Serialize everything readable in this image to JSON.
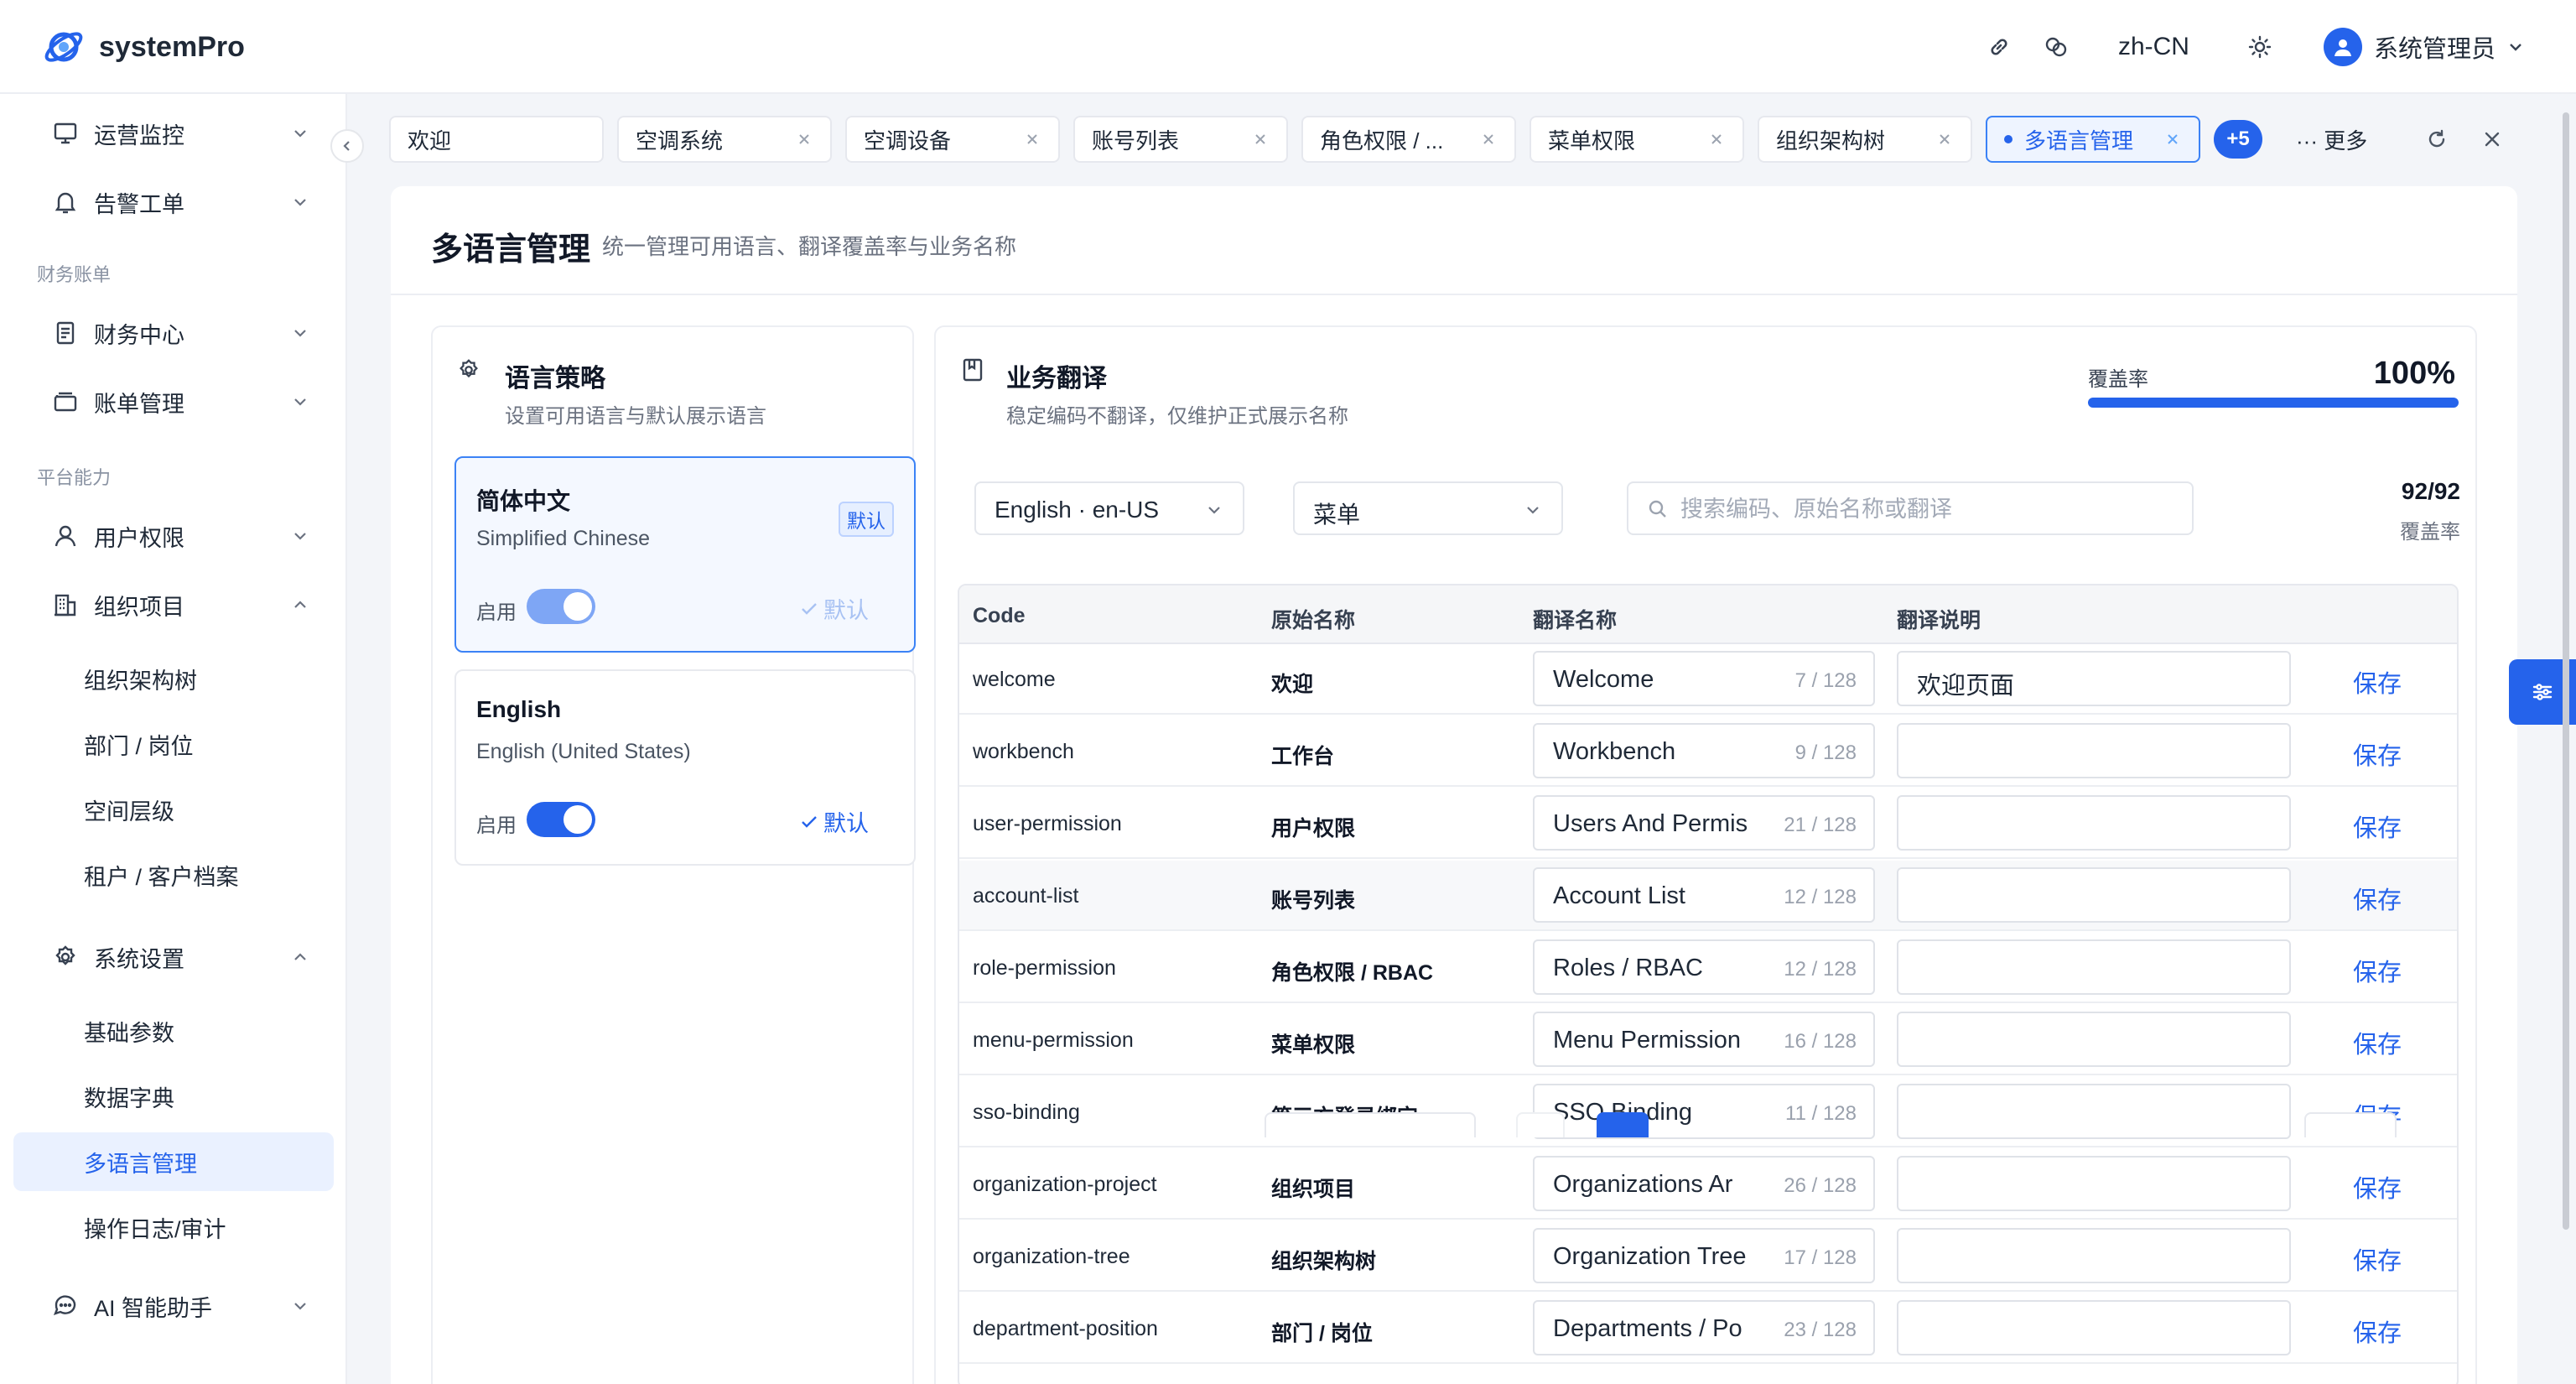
{
  "app": {
    "name": "systemPro",
    "locale": "zh-CN",
    "user": "系统管理员"
  },
  "sidebar": {
    "items": [
      {
        "label": "运营监控"
      },
      {
        "label": "告警工单"
      },
      {
        "group": "财务账单"
      },
      {
        "label": "财务中心"
      },
      {
        "label": "账单管理"
      },
      {
        "group": "平台能力"
      },
      {
        "label": "用户权限"
      },
      {
        "label": "组织项目"
      },
      {
        "sub": "组织架构树"
      },
      {
        "sub": "部门 / 岗位"
      },
      {
        "sub": "空间层级"
      },
      {
        "sub": "租户 / 客户档案"
      },
      {
        "label": "系统设置"
      },
      {
        "sub": "基础参数"
      },
      {
        "sub": "数据字典"
      },
      {
        "sub": "多语言管理",
        "active": true
      },
      {
        "sub": "操作日志/审计"
      },
      {
        "label": "AI 智能助手"
      }
    ]
  },
  "tabs": [
    {
      "label": "欢迎"
    },
    {
      "label": "空调系统"
    },
    {
      "label": "空调设备"
    },
    {
      "label": "账号列表"
    },
    {
      "label": "角色权限 / ..."
    },
    {
      "label": "菜单权限"
    },
    {
      "label": "组织架构树"
    },
    {
      "label": "多语言管理",
      "active": true
    }
  ],
  "tabs_extra": {
    "badge": "+5",
    "more": "··· 更多"
  },
  "page": {
    "title": "多语言管理",
    "subtitle": "统一管理可用语言、翻译覆盖率与业务名称"
  },
  "strategy": {
    "title": "语言策略",
    "subtitle": "设置可用语言与默认展示语言",
    "languages": [
      {
        "name": "简体中文",
        "english": "Simplified Chinese",
        "badge": "默认",
        "enable_label": "启用",
        "default_label": "默认"
      },
      {
        "name": "English",
        "english": "English (United States)",
        "enable_label": "启用",
        "default_label": "默认"
      }
    ]
  },
  "translation": {
    "title": "业务翻译",
    "subtitle": "稳定编码不翻译，仅维护正式展示名称",
    "coverage_label": "覆盖率",
    "coverage_value": "100%",
    "coverage_fraction": 1.0,
    "language_select": "English · en-US",
    "module_select": "菜单",
    "search_placeholder": "搜索编码、原始名称或翻译",
    "count": "92/92",
    "count_label": "覆盖率",
    "columns": [
      "Code",
      "原始名称",
      "翻译名称",
      "翻译说明"
    ],
    "save_label": "保存",
    "rows": [
      {
        "code": "welcome",
        "name": "欢迎",
        "translation": "Welcome",
        "count": "7 / 128",
        "note": "欢迎页面"
      },
      {
        "code": "workbench",
        "name": "工作台",
        "translation": "Workbench",
        "count": "9 / 128",
        "note": ""
      },
      {
        "code": "user-permission",
        "name": "用户权限",
        "translation": "Users And Permis",
        "count": "21 / 128",
        "note": ""
      },
      {
        "code": "account-list",
        "name": "账号列表",
        "translation": "Account List",
        "count": "12 / 128",
        "note": ""
      },
      {
        "code": "role-permission",
        "name": "角色权限 / RBAC",
        "translation": "Roles / RBAC",
        "count": "12 / 128",
        "note": ""
      },
      {
        "code": "menu-permission",
        "name": "菜单权限",
        "translation": "Menu Permission",
        "count": "16 / 128",
        "note": ""
      },
      {
        "code": "sso-binding",
        "name": "第三方登录绑定",
        "translation": "SSO Binding",
        "count": "11 / 128",
        "note": ""
      },
      {
        "code": "organization-project",
        "name": "组织项目",
        "translation": "Organizations Ar",
        "count": "26 / 128",
        "note": ""
      },
      {
        "code": "organization-tree",
        "name": "组织架构树",
        "translation": "Organization Tree",
        "count": "17 / 128",
        "note": ""
      },
      {
        "code": "department-position",
        "name": "部门 / 岗位",
        "translation": "Departments / Po",
        "count": "23 / 128",
        "note": ""
      }
    ]
  },
  "colors": {
    "accent": "#2563eb",
    "active_bg": "#eaf1ff",
    "border": "#e6e8ee"
  }
}
